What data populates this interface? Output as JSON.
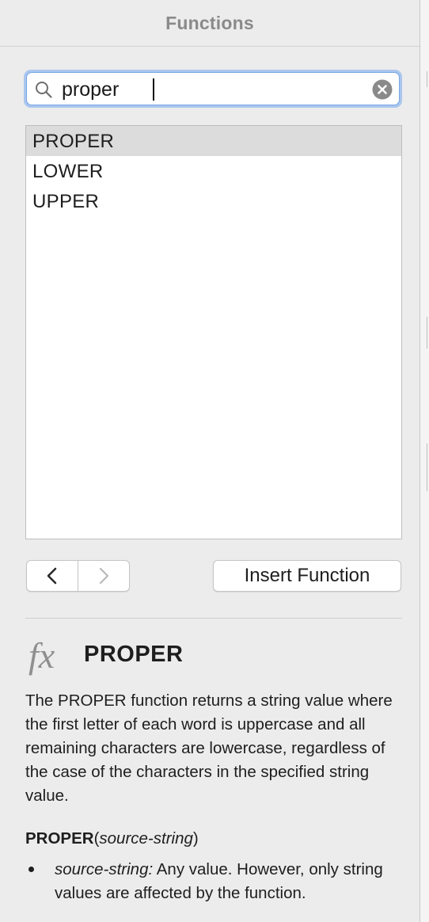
{
  "header": {
    "title": "Functions"
  },
  "search": {
    "value": "proper",
    "icon": "search-icon",
    "clear_icon": "clear-icon"
  },
  "results": {
    "items": [
      {
        "label": "PROPER",
        "selected": true
      },
      {
        "label": "LOWER",
        "selected": false
      },
      {
        "label": "UPPER",
        "selected": false
      }
    ]
  },
  "navigation": {
    "back_icon": "chevron-left-icon",
    "forward_icon": "chevron-right-icon",
    "forward_enabled": false
  },
  "insert_button": {
    "label": "Insert Function"
  },
  "detail": {
    "icon_label": "fx",
    "name": "PROPER",
    "description": "The PROPER function returns a string value where the first letter of each word is uppercase and all remaining characters are lowercase, regardless of the case of the characters in the specified string value.",
    "syntax": {
      "function": "PROPER",
      "open": "(",
      "argument": "source-string",
      "close": ")"
    },
    "arguments": [
      {
        "term": "source-string:",
        "text": " Any value. However, only string values are affected by the function."
      }
    ]
  },
  "colors": {
    "panel_background": "#ececec",
    "selection_background": "#dcdcdc",
    "focus_ring": "#a9c6ee"
  }
}
